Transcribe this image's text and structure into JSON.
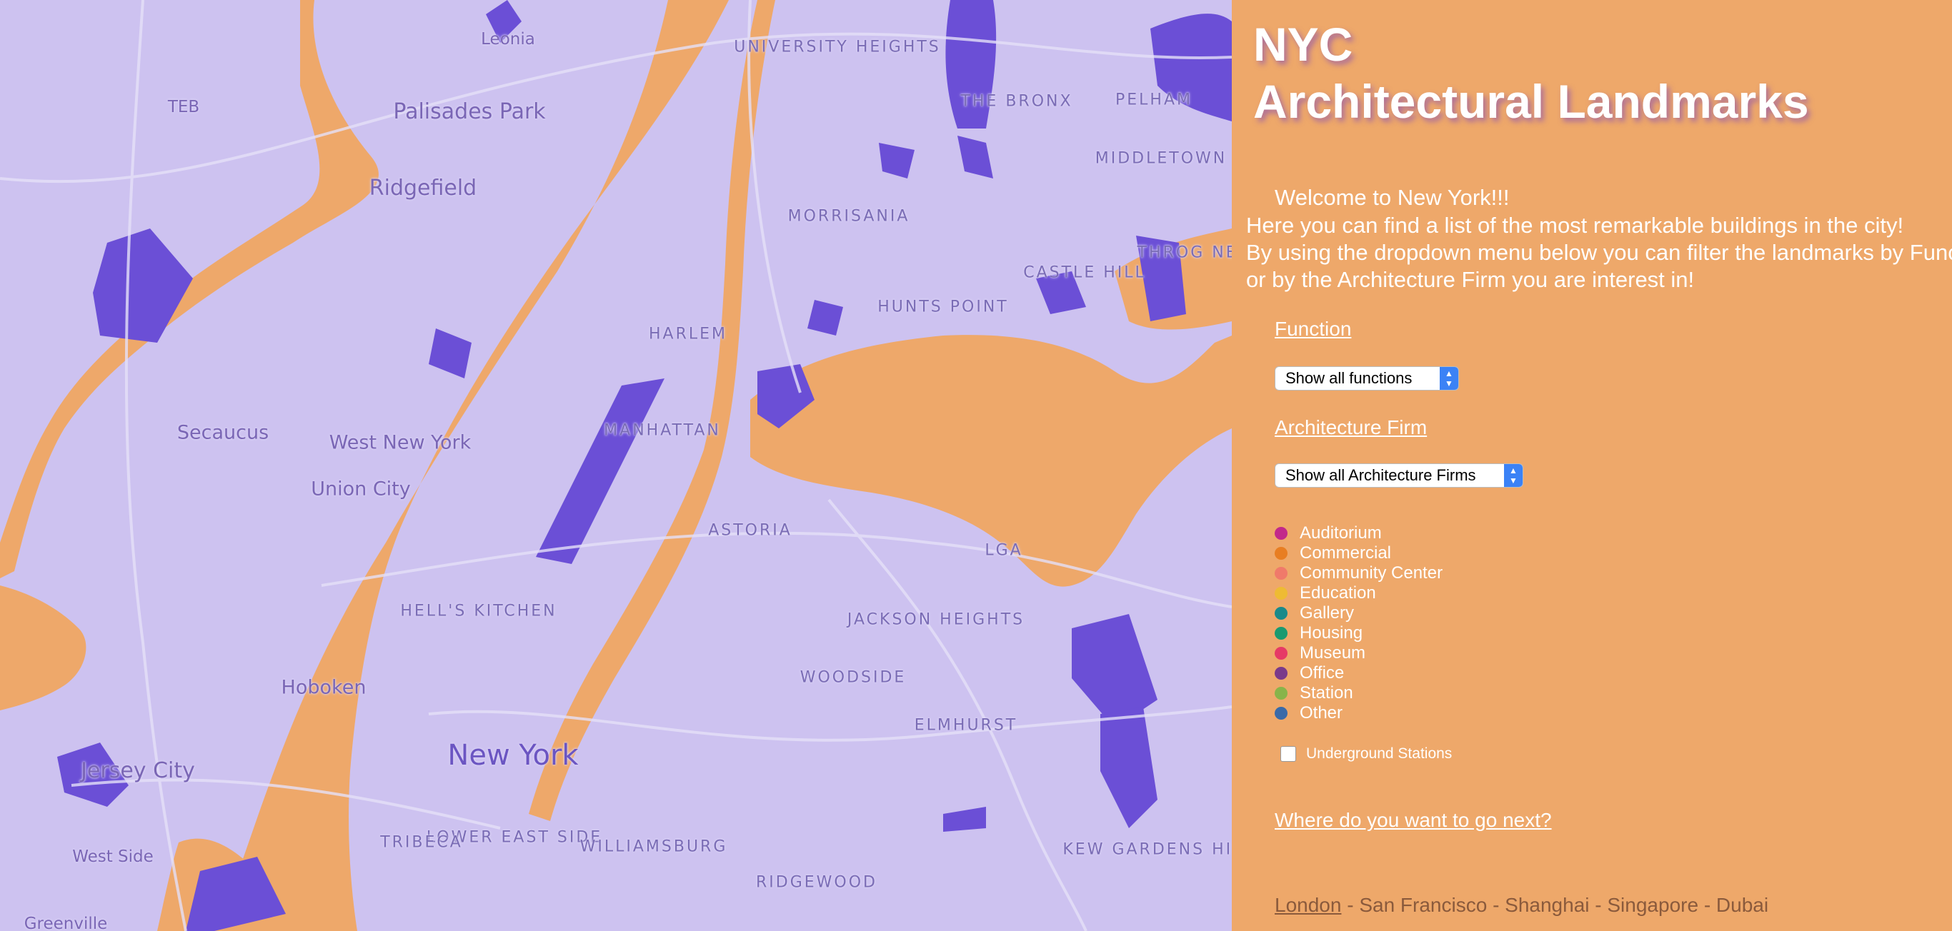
{
  "map": {
    "labels": [
      {
        "name": "Leonia",
        "style": "city-xs"
      },
      {
        "name": "TEB",
        "style": "city-xs"
      },
      {
        "name": "Palisades Park",
        "style": "city-md"
      },
      {
        "name": "Ridgefield",
        "style": "city-md"
      },
      {
        "name": "Secaucus",
        "style": "city-sm"
      },
      {
        "name": "West New York",
        "style": "city-sm"
      },
      {
        "name": "Union City",
        "style": "city-sm"
      },
      {
        "name": "Hoboken",
        "style": "city-sm"
      },
      {
        "name": "Jersey City",
        "style": "city-md"
      },
      {
        "name": "West Side",
        "style": "city-xs"
      },
      {
        "name": "Greenville",
        "style": "city-xs"
      },
      {
        "name": "New York",
        "style": "city-lg"
      },
      {
        "name": "UNIVERSITY HEIGHTS",
        "style": "hood"
      },
      {
        "name": "THE BRONX",
        "style": "hood"
      },
      {
        "name": "PELHAM",
        "style": "hood"
      },
      {
        "name": "MIDDLETOWN",
        "style": "hood"
      },
      {
        "name": "MORRISANIA",
        "style": "hood"
      },
      {
        "name": "THROG NECK",
        "style": "hood"
      },
      {
        "name": "CASTLE HILL",
        "style": "hood"
      },
      {
        "name": "HUNTS POINT",
        "style": "hood"
      },
      {
        "name": "HARLEM",
        "style": "hood"
      },
      {
        "name": "MANHATTAN",
        "style": "hood"
      },
      {
        "name": "ASTORIA",
        "style": "hood"
      },
      {
        "name": "LGA",
        "style": "hood"
      },
      {
        "name": "JACKSON HEIGHTS",
        "style": "hood"
      },
      {
        "name": "HELL'S KITCHEN",
        "style": "hood"
      },
      {
        "name": "WOODSIDE",
        "style": "hood"
      },
      {
        "name": "ELMHURST",
        "style": "hood"
      },
      {
        "name": "LOWER EAST SIDE",
        "style": "hood"
      },
      {
        "name": "TRIBECA",
        "style": "hood"
      },
      {
        "name": "WILLIAMSBURG",
        "style": "hood"
      },
      {
        "name": "RIDGEWOOD",
        "style": "hood"
      },
      {
        "name": "KEW GARDENS HILLS",
        "style": "hood"
      }
    ]
  },
  "panel": {
    "title_line1": "NYC",
    "title_line2": "Architectural Landmarks",
    "intro_line1": "Welcome to New York!!!",
    "intro_line2": "Here you can find a list of the most remarkable buildings in the city!",
    "intro_line3": "By using the dropdown menu below you can filter the landmarks by Function",
    "intro_line4": "or by the Architecture Firm you are interest in!",
    "function_label": "Function",
    "function_select": "Show all functions",
    "firm_label": "Architecture Firm",
    "firm_select": "Show all Architecture Firms",
    "legend": [
      {
        "label": "Auditorium",
        "color": "#c2298a"
      },
      {
        "label": "Commercial",
        "color": "#e87e22"
      },
      {
        "label": "Community Center",
        "color": "#f07a6a"
      },
      {
        "label": "Education",
        "color": "#eebb33"
      },
      {
        "label": "Gallery",
        "color": "#1a8a8a"
      },
      {
        "label": "Housing",
        "color": "#1a9a70"
      },
      {
        "label": "Museum",
        "color": "#e63a66"
      },
      {
        "label": "Office",
        "color": "#7a3a8a"
      },
      {
        "label": "Station",
        "color": "#88b44a"
      },
      {
        "label": "Other",
        "color": "#3a6aa8"
      }
    ],
    "underground_label": "Underground Stations",
    "next_link": "Where do you want to go next?",
    "cities": {
      "current": "London",
      "others": " - San Francisco - Shanghai - Singapore - Dubai"
    }
  },
  "colors": {
    "panel_bg": "#eea86a",
    "land": "#cdc2f0",
    "water": "#eea86a",
    "parks": "#6b4fd6"
  }
}
